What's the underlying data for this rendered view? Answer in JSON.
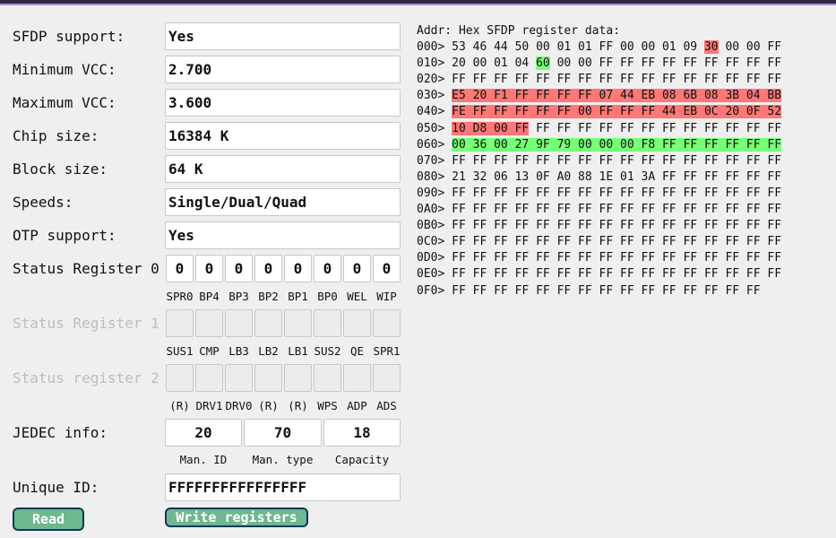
{
  "fields": [
    {
      "label": "SFDP support:",
      "value": "Yes"
    },
    {
      "label": "Minimum VCC:",
      "value": "2.700"
    },
    {
      "label": "Maximum VCC:",
      "value": "3.600"
    },
    {
      "label": "Chip size:",
      "value": "16384 K"
    },
    {
      "label": "Block size:",
      "value": "64 K"
    },
    {
      "label": "Speeds:",
      "value": "Single/Dual/Quad"
    },
    {
      "label": "OTP support:",
      "value": "Yes"
    }
  ],
  "status": [
    {
      "label": "Status Register 0",
      "enabled": true,
      "values": [
        "0",
        "0",
        "0",
        "0",
        "0",
        "0",
        "0",
        "0"
      ],
      "bits": [
        "SPR0",
        "BP4",
        "BP3",
        "BP2",
        "BP1",
        "BP0",
        "WEL",
        "WIP"
      ]
    },
    {
      "label": "Status Register 1",
      "enabled": false,
      "values": [
        "",
        "",
        "",
        "",
        "",
        "",
        "",
        ""
      ],
      "bits": [
        "SUS1",
        "CMP",
        "LB3",
        "LB2",
        "LB1",
        "SUS2",
        "QE",
        "SPR1"
      ]
    },
    {
      "label": "Status register 2",
      "enabled": false,
      "values": [
        "",
        "",
        "",
        "",
        "",
        "",
        "",
        ""
      ],
      "bits": [
        "(R)",
        "DRV1",
        "DRV0",
        "(R)",
        "(R)",
        "WPS",
        "ADP",
        "ADS"
      ]
    }
  ],
  "jedec": {
    "label": "JEDEC info:",
    "values": [
      "20",
      "70",
      "18"
    ],
    "captions": [
      "Man. ID",
      "Man. type",
      "Capacity"
    ]
  },
  "unique_id": {
    "label": "Unique ID:",
    "value": "FFFFFFFFFFFFFFFF"
  },
  "buttons": {
    "read": "Read",
    "write": "Write registers"
  },
  "hex": {
    "header_addr": "Addr:",
    "header_title": "Hex SFDP register data:",
    "rows": [
      {
        "addr": "000>",
        "bytes": "53 46 44 50 00 01 01 FF 00 00 01 09 30 00 00 FF"
      },
      {
        "addr": "010>",
        "bytes": "20 00 01 04 60 00 00 FF FF FF FF FF FF FF FF FF"
      },
      {
        "addr": "020>",
        "bytes": "FF FF FF FF FF FF FF FF FF FF FF FF FF FF FF FF"
      },
      {
        "addr": "030>",
        "bytes": "E5 20 F1 FF FF FF FF 07 44 EB 08 6B 08 3B 04 BB"
      },
      {
        "addr": "040>",
        "bytes": "FE FF FF FF FF FF 00 FF FF FF 44 EB 0C 20 0F 52"
      },
      {
        "addr": "050>",
        "bytes": "10 D8 00 FF FF FF FF FF FF FF FF FF FF FF FF FF"
      },
      {
        "addr": "060>",
        "bytes": "00 36 00 27 9F 79 00 00 00 F8 FF FF FF FF FF FF"
      },
      {
        "addr": "070>",
        "bytes": "FF FF FF FF FF FF FF FF FF FF FF FF FF FF FF FF"
      },
      {
        "addr": "080>",
        "bytes": "21 32 06 13 0F A0 88 1E 01 3A FF FF FF FF FF FF"
      },
      {
        "addr": "090>",
        "bytes": "FF FF FF FF FF FF FF FF FF FF FF FF FF FF FF FF"
      },
      {
        "addr": "0A0>",
        "bytes": "FF FF FF FF FF FF FF FF FF FF FF FF FF FF FF FF"
      },
      {
        "addr": "0B0>",
        "bytes": "FF FF FF FF FF FF FF FF FF FF FF FF FF FF FF FF"
      },
      {
        "addr": "0C0>",
        "bytes": "FF FF FF FF FF FF FF FF FF FF FF FF FF FF FF FF"
      },
      {
        "addr": "0D0>",
        "bytes": "FF FF FF FF FF FF FF FF FF FF FF FF FF FF FF FF"
      },
      {
        "addr": "0E0>",
        "bytes": "FF FF FF FF FF FF FF FF FF FF FF FF FF FF FF FF"
      },
      {
        "addr": "0F0>",
        "bytes": "FF FF FF FF FF FF FF FF FF FF FF FF FF FF FF"
      }
    ],
    "highlights": [
      {
        "color": "red",
        "from": 12,
        "to": 12
      },
      {
        "color": "red",
        "from": 48,
        "to": 83
      },
      {
        "color": "green",
        "from": 20,
        "to": 20
      },
      {
        "color": "green",
        "from": 96,
        "to": 111
      }
    ]
  }
}
